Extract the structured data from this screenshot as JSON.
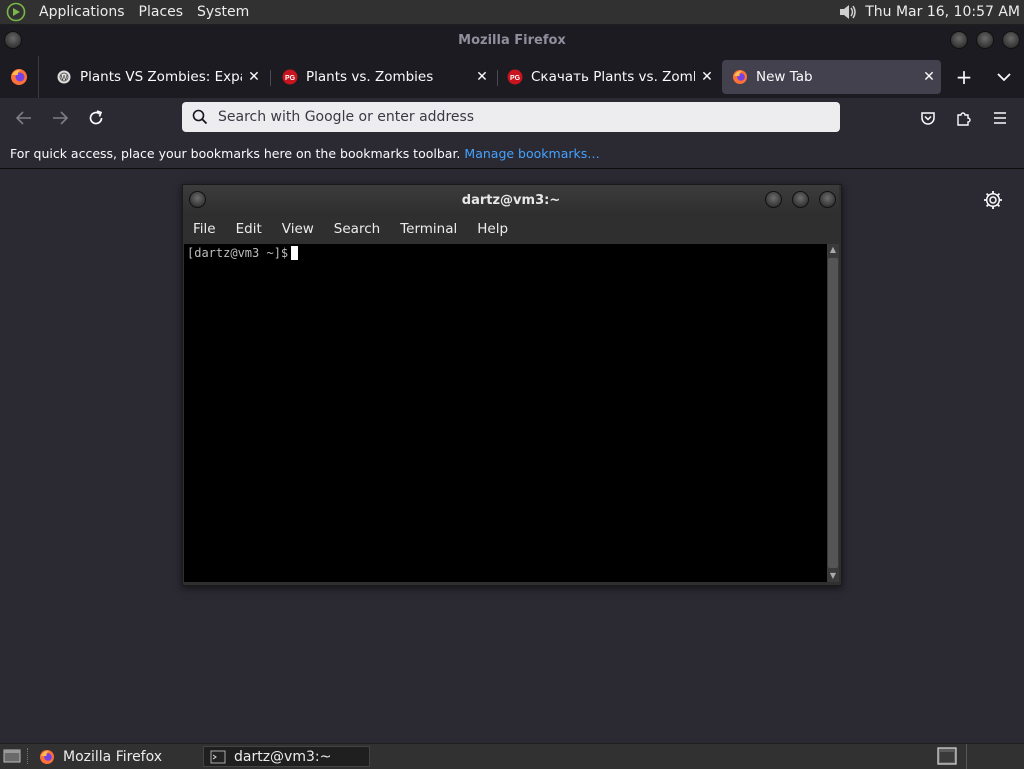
{
  "top_panel": {
    "menus": [
      "Applications",
      "Places",
      "System"
    ],
    "clock": "Thu Mar 16, 10:57 AM"
  },
  "firefox": {
    "window_title": "Mozilla Firefox",
    "tabs": [
      {
        "label": "Plants VS Zombies: Expande",
        "favicon": "wiki-icon"
      },
      {
        "label": "Plants vs. Zombies",
        "favicon": "pg-icon"
      },
      {
        "label": "Скачать Plants vs. Zombies",
        "favicon": "pg-icon"
      },
      {
        "label": "New Tab",
        "favicon": "firefox-icon"
      }
    ],
    "urlbar": {
      "placeholder": "Search with Google or enter address",
      "value": ""
    },
    "bookmarks_bar": {
      "text": "For quick access, place your bookmarks here on the bookmarks toolbar.",
      "link": "Manage bookmarks…"
    }
  },
  "terminal": {
    "title": "dartz@vm3:~",
    "menus": [
      "File",
      "Edit",
      "View",
      "Search",
      "Terminal",
      "Help"
    ],
    "prompt": "[dartz@vm3 ~]$"
  },
  "bottom_panel": {
    "tasks": [
      "Mozilla Firefox",
      "dartz@vm3:~"
    ]
  },
  "colors": {
    "firefox_bg": "#2b2a33",
    "tab_strip_bg": "#1c1b22",
    "link": "#45a1ff",
    "terminal_bg": "#000000"
  }
}
